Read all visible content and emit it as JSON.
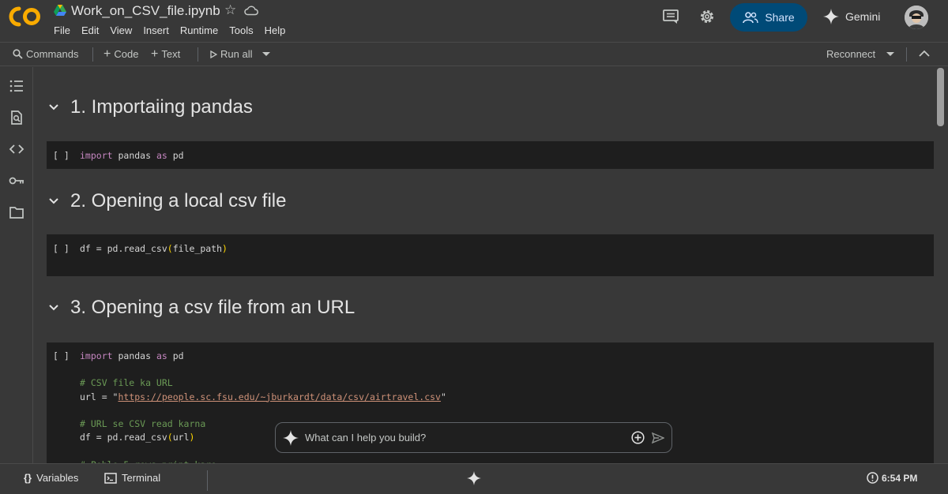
{
  "header": {
    "title": "Work_on_CSV_file.ipynb",
    "menu": [
      "File",
      "Edit",
      "View",
      "Insert",
      "Runtime",
      "Tools",
      "Help"
    ],
    "share_label": "Share",
    "gemini_label": "Gemini",
    "icons": [
      "colab-logo",
      "drive-icon",
      "star-icon",
      "cloud-icon",
      "comment-icon",
      "settings-icon",
      "people-icon",
      "gemini-icon",
      "avatar"
    ]
  },
  "toolbar": {
    "commands_label": "Commands",
    "code_label": "Code",
    "text_label": "Text",
    "run_all_label": "Run all",
    "reconnect_label": "Reconnect"
  },
  "sidebar": {
    "items": [
      "table-of-contents-icon",
      "find-icon",
      "code-snippets-icon",
      "secrets-key-icon",
      "files-folder-icon"
    ]
  },
  "notebook": {
    "sections": [
      {
        "title": "1. Importaiing pandas"
      },
      {
        "title": "2. Opening a local csv file"
      },
      {
        "title": "3. Opening a csv file from an URL"
      }
    ],
    "cells": [
      {
        "run_label": "[ ]"
      },
      {
        "run_label": "[ ]"
      },
      {
        "run_label": "[ ]"
      }
    ]
  },
  "gemini_prompt": {
    "placeholder": "What can I help you build?"
  },
  "statusbar": {
    "variables_label": "Variables",
    "terminal_label": "Terminal",
    "time": "6:54 PM"
  },
  "colors": {
    "background": "#383838",
    "cell_background": "#1e1e1e",
    "share_button": "#004a77",
    "keyword": "#c586c0",
    "comment": "#6a9955",
    "string": "#ce9178",
    "logo_orange": "#f9ab00"
  }
}
